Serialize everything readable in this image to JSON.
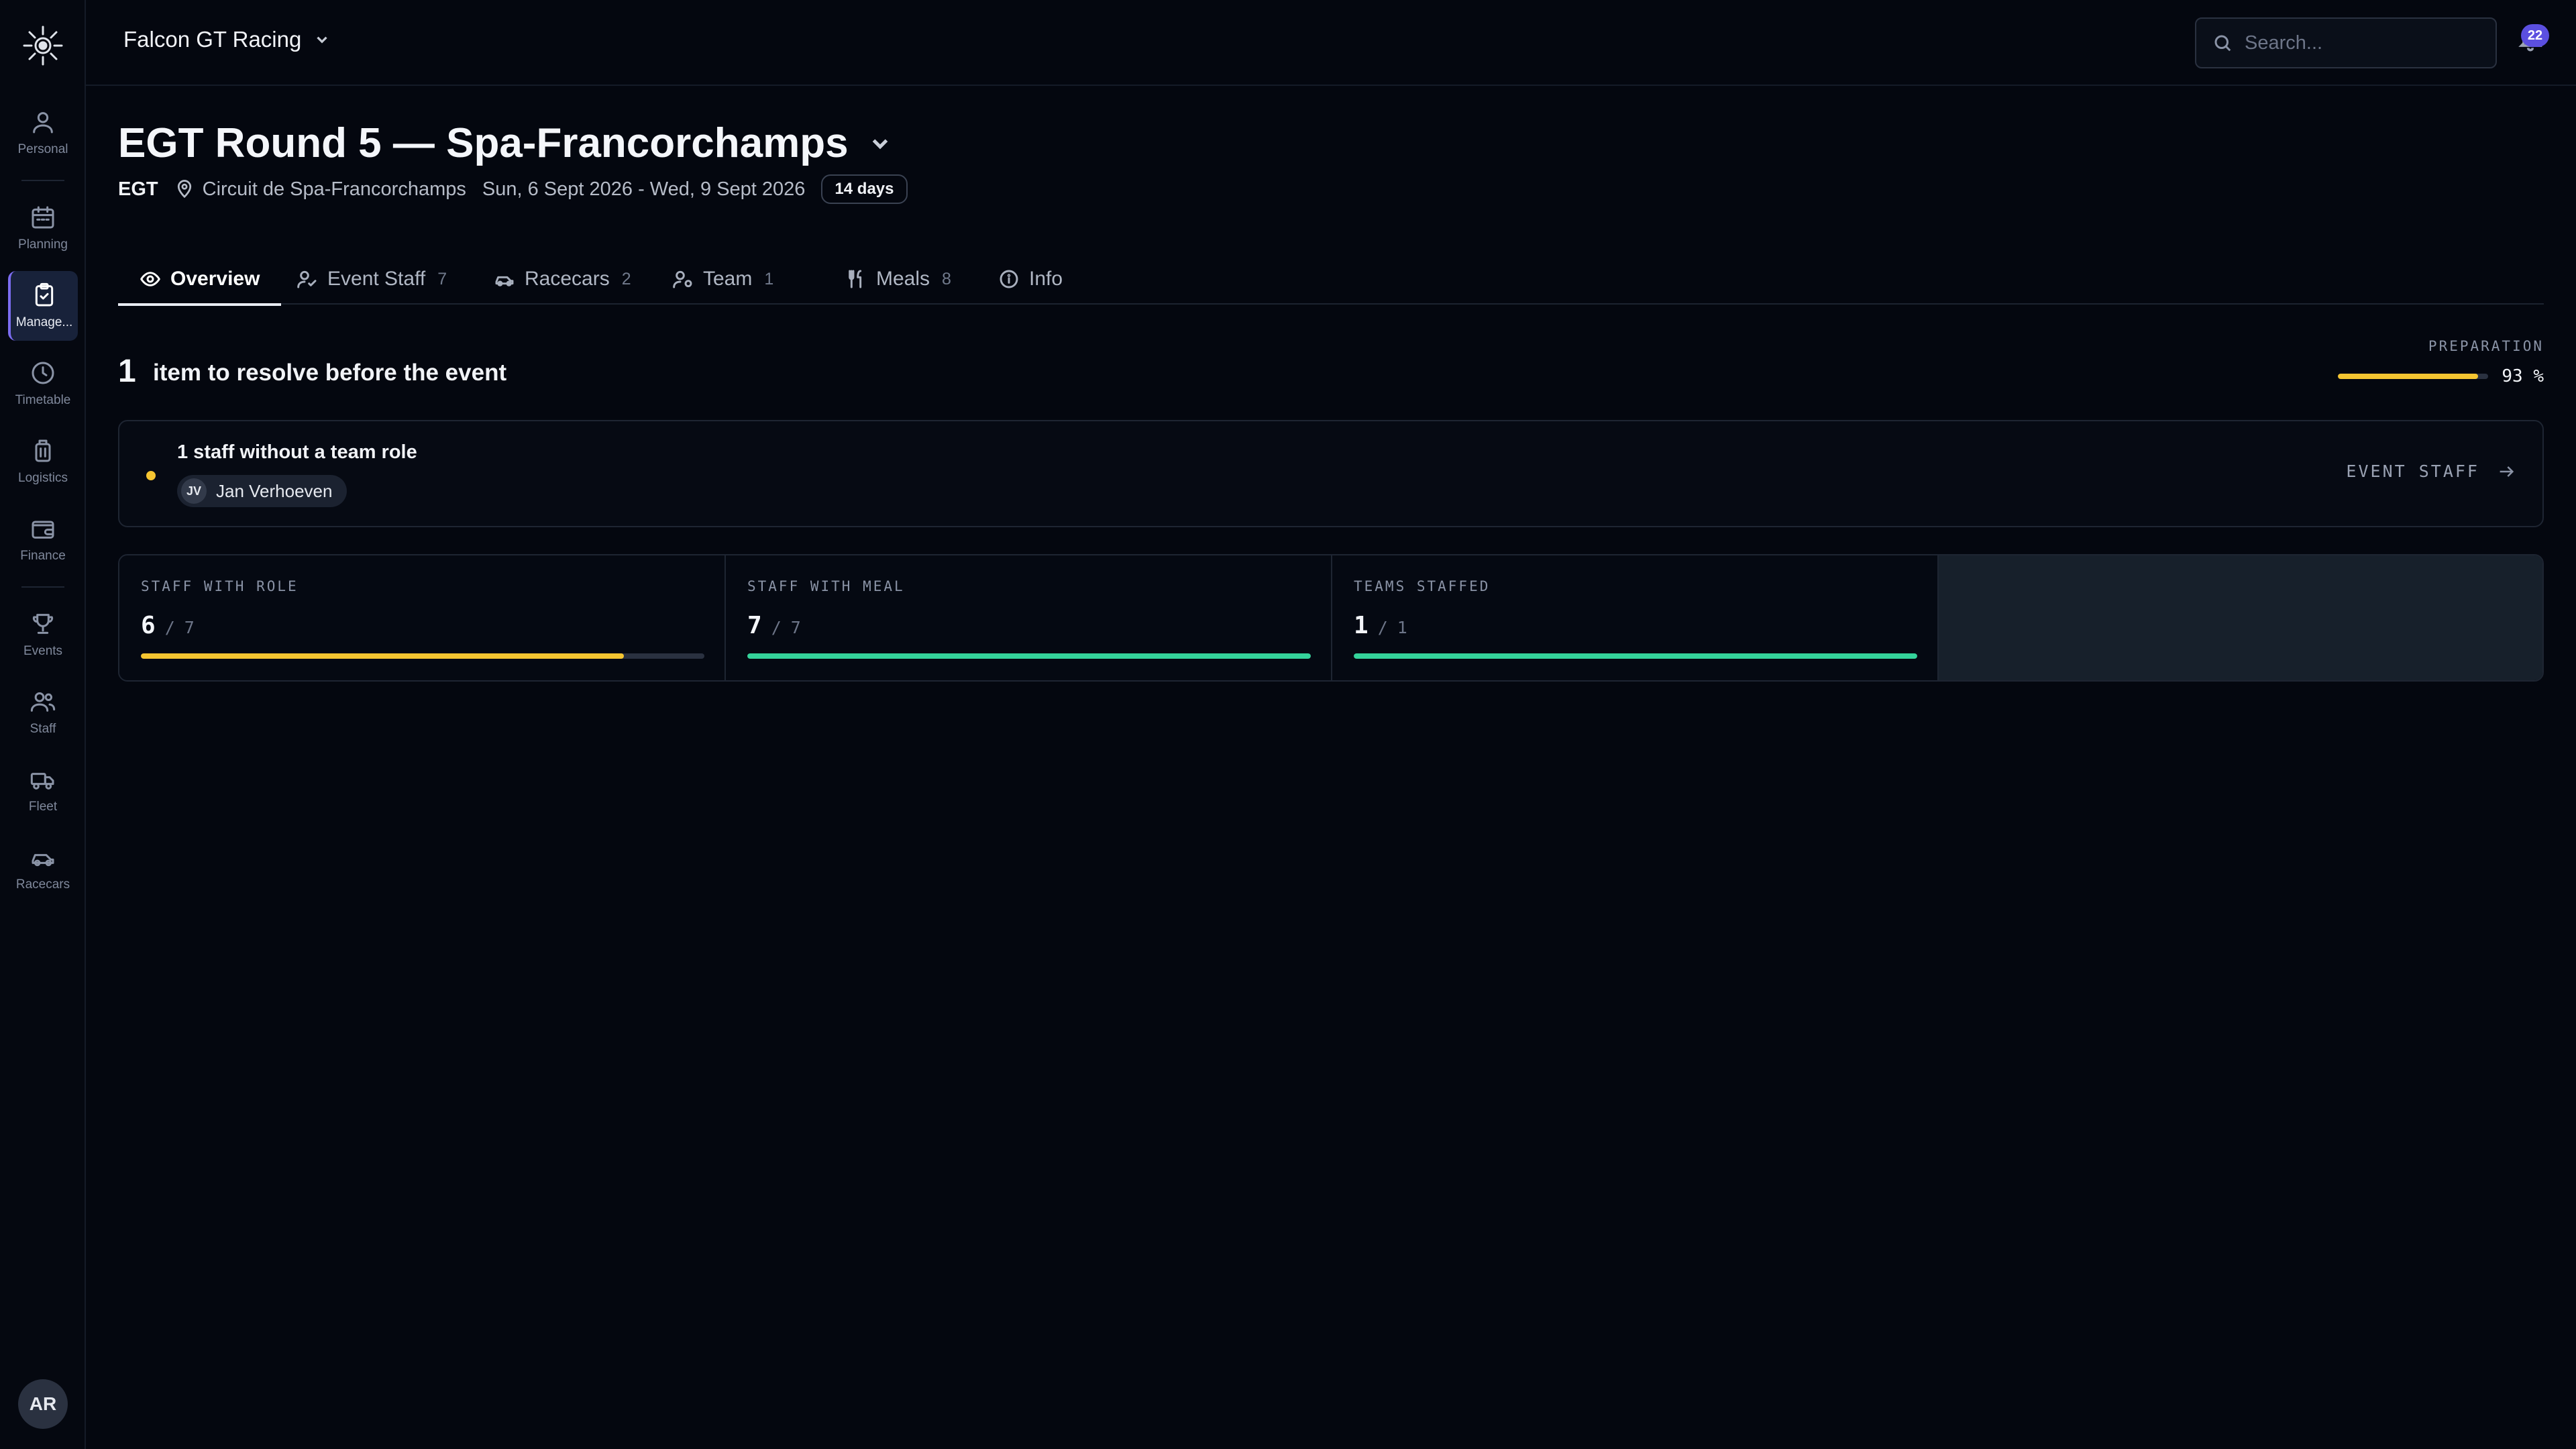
{
  "app": {
    "org_name": "Falcon GT Racing",
    "notifications_count": "22",
    "user_initials": "AR"
  },
  "sidebar": {
    "items": [
      {
        "label": "Personal",
        "icon": "user-icon"
      },
      {
        "label": "Planning",
        "icon": "calendar-icon"
      },
      {
        "label": "Manage...",
        "icon": "clipboard-check-icon",
        "active": true
      },
      {
        "label": "Timetable",
        "icon": "clock-icon"
      },
      {
        "label": "Logistics",
        "icon": "luggage-icon"
      },
      {
        "label": "Finance",
        "icon": "wallet-icon"
      },
      {
        "label": "Events",
        "icon": "trophy-icon"
      },
      {
        "label": "Staff",
        "icon": "users-icon"
      },
      {
        "label": "Fleet",
        "icon": "truck-icon"
      },
      {
        "label": "Racecars",
        "icon": "car-icon"
      }
    ]
  },
  "search": {
    "placeholder": "Search..."
  },
  "event": {
    "title": "EGT Round 5 — Spa-Francorchamps",
    "series": "EGT",
    "location": "Circuit de Spa-Francorchamps",
    "dates": "Sun, 6 Sept 2026 - Wed, 9 Sept 2026",
    "countdown": "14 days"
  },
  "tabs": [
    {
      "label": "Overview",
      "count": "",
      "icon": "eye-icon",
      "active": true
    },
    {
      "label": "Event Staff",
      "count": "7",
      "icon": "user-check-icon"
    },
    {
      "label": "Racecars",
      "count": "2",
      "icon": "car-icon"
    },
    {
      "label": "Team",
      "count": "1",
      "icon": "user-cog-icon"
    },
    {
      "label": "Meals",
      "count": "8",
      "icon": "utensils-icon"
    },
    {
      "label": "Info",
      "count": "",
      "icon": "info-icon"
    }
  ],
  "overview": {
    "resolve_count": "1",
    "resolve_text": "item to resolve before the event",
    "preparation_label": "PREPARATION",
    "preparation_value": "93 %",
    "preparation_fraction": 0.93,
    "issue": {
      "title": "1 staff without a team role",
      "person_initials": "JV",
      "person_name": "Jan Verhoeven",
      "link_label": "EVENT STAFF"
    },
    "stats": [
      {
        "label": "STAFF WITH ROLE",
        "value": "6",
        "total": "7",
        "fraction": 0.857,
        "color": "#f5c531"
      },
      {
        "label": "STAFF WITH MEAL",
        "value": "7",
        "total": "7",
        "fraction": 1.0,
        "color": "#34d39a"
      },
      {
        "label": "TEAMS STAFFED",
        "value": "1",
        "total": "1",
        "fraction": 1.0,
        "color": "#34d39a"
      }
    ]
  }
}
